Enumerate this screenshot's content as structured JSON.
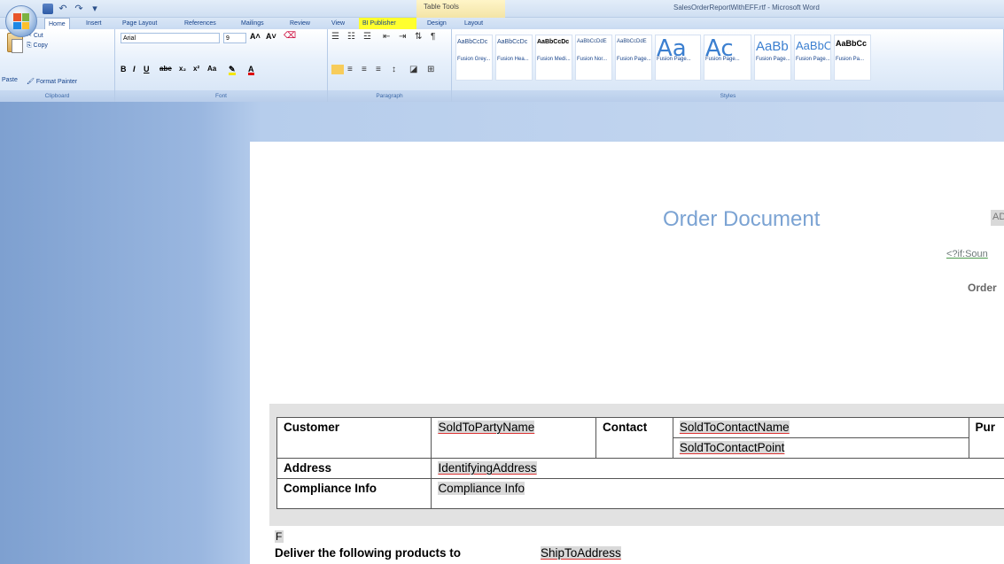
{
  "window": {
    "title": "SalesOrderReportWithEFF.rtf - Microsoft Word",
    "contextual_tab_group": "Table Tools"
  },
  "tabs": [
    "Home",
    "Insert",
    "Page Layout",
    "References",
    "Mailings",
    "Review",
    "View",
    "BI Publisher",
    "Design",
    "Layout"
  ],
  "ribbon": {
    "clipboard": {
      "paste": "Paste",
      "cut": "Cut",
      "copy": "Copy",
      "format_painter": "Format Painter",
      "label": "Clipboard"
    },
    "font": {
      "name": "Arial",
      "size": "9",
      "label": "Font"
    },
    "paragraph": {
      "label": "Paragraph"
    },
    "styles": {
      "label": "Styles",
      "items": [
        {
          "preview": "AaBbCcDc",
          "name": "Fusion Grey..."
        },
        {
          "preview": "AaBbCcDc",
          "name": "Fusion Hea..."
        },
        {
          "preview": "AaBbCcDc",
          "name": "Fusion Medi..."
        },
        {
          "preview": "AaBbCcDdE",
          "name": "Fusion Nor..."
        },
        {
          "preview": "AaBbCcDdE",
          "name": "Fusion Page..."
        },
        {
          "preview": "Aa",
          "name": "Fusion Page..."
        },
        {
          "preview": "Ac",
          "name": "Fusion Page..."
        },
        {
          "preview": "AaBb",
          "name": "Fusion Page..."
        },
        {
          "preview": "AaBbC",
          "name": "Fusion Page..."
        },
        {
          "preview": "AaBbCc",
          "name": "Fusion Pa..."
        }
      ]
    }
  },
  "document": {
    "title": "Order Document",
    "right_field": "AD",
    "if_field": "<?if:Soun",
    "order_label": "Order",
    "table": {
      "customer_label": "Customer",
      "customer_value": "SoldToPartyName",
      "contact_label": "Contact",
      "contact_name": "SoldToContactName",
      "contact_point": "SoldToContactPoint",
      "pur_label": "Pur",
      "address_label": "Address",
      "address_value": "IdentifyingAddress",
      "compliance_label": "Compliance Info",
      "compliance_value": "Compliance Info"
    },
    "para_f": "F",
    "deliver_text": "Deliver the following products to",
    "ship_to_field": "ShipToAddress"
  }
}
